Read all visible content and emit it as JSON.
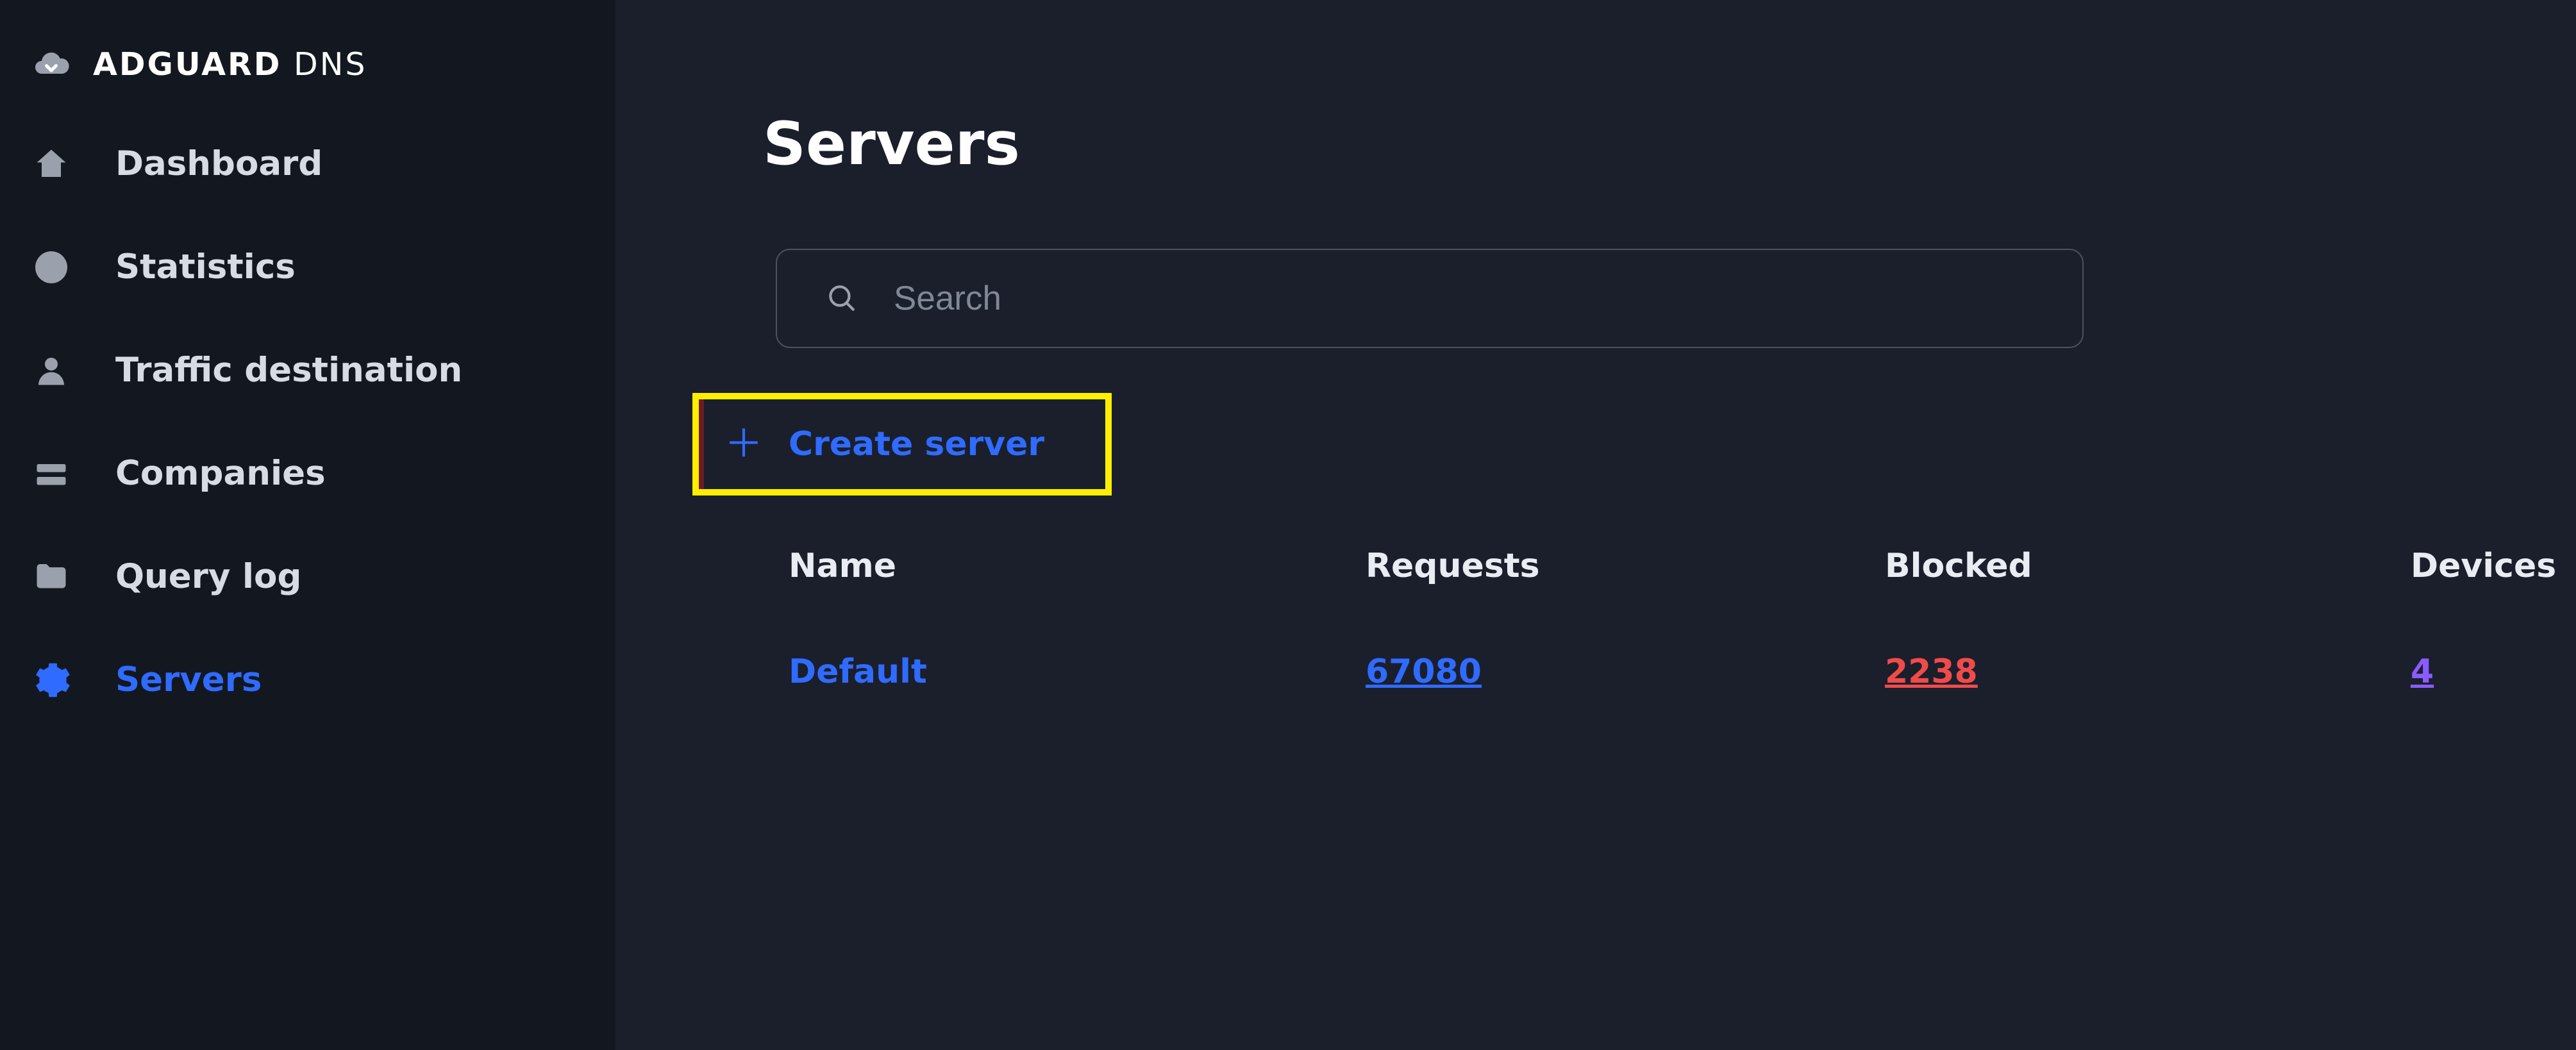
{
  "brand": {
    "strong": "ADGUARD",
    "light": "DNS"
  },
  "sidebar": {
    "items": [
      {
        "label": "Dashboard",
        "icon": "home-icon"
      },
      {
        "label": "Statistics",
        "icon": "pie-icon"
      },
      {
        "label": "Traffic destination",
        "icon": "person-icon"
      },
      {
        "label": "Companies",
        "icon": "bars-icon"
      },
      {
        "label": "Query log",
        "icon": "folder-icon"
      },
      {
        "label": "Servers",
        "icon": "gear-icon"
      }
    ],
    "activeIndex": 5
  },
  "page": {
    "title": "Servers"
  },
  "search": {
    "placeholder": "Search",
    "value": ""
  },
  "create": {
    "label": "Create server"
  },
  "table": {
    "headers": {
      "name": "Name",
      "requests": "Requests",
      "blocked": "Blocked",
      "devices": "Devices"
    },
    "rows": [
      {
        "name": "Default",
        "requests": "67080",
        "blocked": "2238",
        "devices": "4"
      }
    ]
  },
  "colors": {
    "accent": "#2f6bff",
    "danger": "#f04b4b",
    "highlight_border": "#ffee00",
    "purple": "#8a5bff"
  }
}
